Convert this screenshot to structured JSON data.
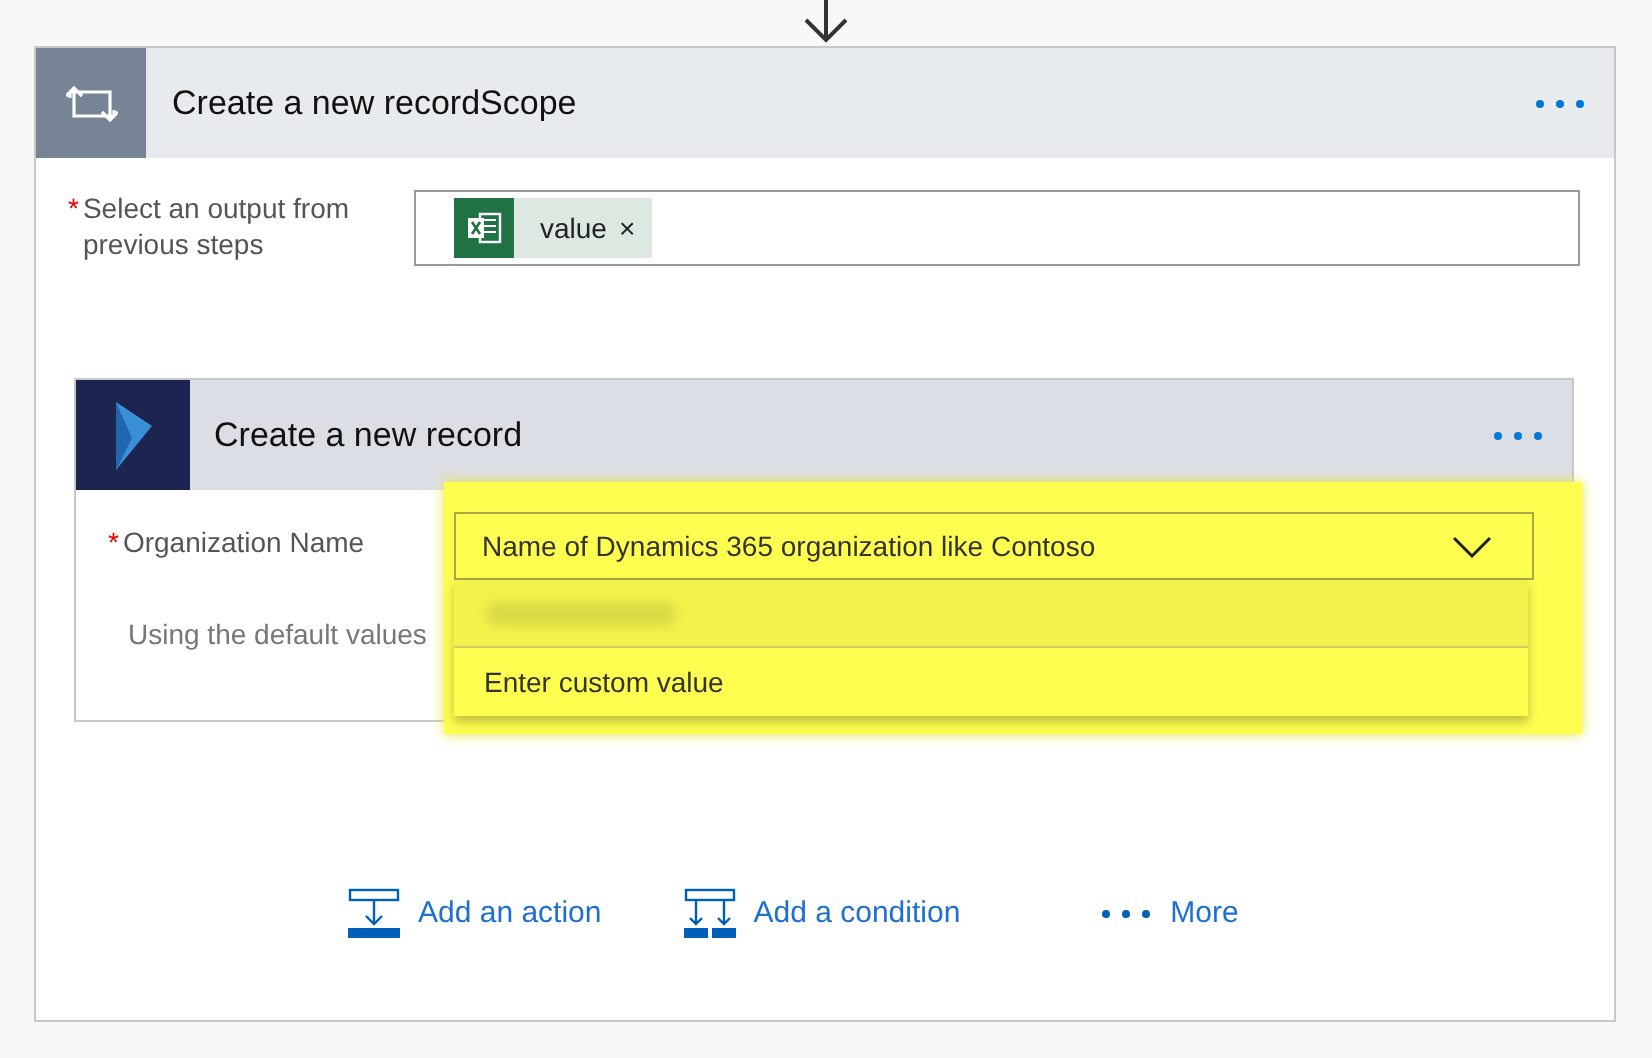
{
  "scope": {
    "title": "Create a new recordScope",
    "output_field": {
      "label": "Select an output from previous steps",
      "required": true,
      "required_mark": "*",
      "tokens": [
        {
          "text": "value",
          "close": "×"
        }
      ]
    }
  },
  "record": {
    "title": "Create a new record",
    "organization": {
      "label": "Organization Name",
      "required": true,
      "required_mark": "*",
      "value": "Name of Dynamics 365 organization like Contoso",
      "expanded": true,
      "options": [
        {
          "kind": "hidden"
        },
        {
          "kind": "text",
          "text": "Enter custom value"
        }
      ]
    },
    "note": "Using the default values"
  },
  "actions": [
    {
      "kind": "action",
      "label": "Add an action"
    },
    {
      "kind": "condition",
      "label": "Add a condition"
    },
    {
      "kind": "more",
      "label": "More"
    }
  ]
}
